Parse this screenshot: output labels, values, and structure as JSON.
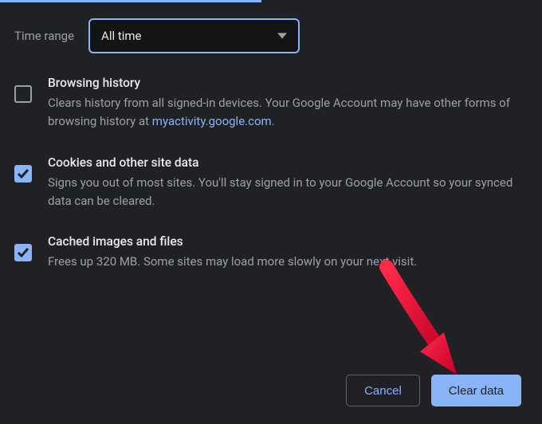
{
  "time_range": {
    "label": "Time range",
    "selected": "All time"
  },
  "options": [
    {
      "checked": false,
      "title": "Browsing history",
      "desc_before": "Clears history from all signed-in devices. Your Google Account may have other forms of browsing history at ",
      "link_text": "myactivity.google.com",
      "desc_after": "."
    },
    {
      "checked": true,
      "title": "Cookies and other site data",
      "desc_before": "Signs you out of most sites. You'll stay signed in to your Google Account so your synced data can be cleared.",
      "link_text": "",
      "desc_after": ""
    },
    {
      "checked": true,
      "title": "Cached images and files",
      "desc_before": "Frees up 320 MB. Some sites may load more slowly on your next visit.",
      "link_text": "",
      "desc_after": ""
    }
  ],
  "buttons": {
    "cancel": "Cancel",
    "clear": "Clear data"
  },
  "colors": {
    "accent": "#8ab4f8",
    "background": "#202124",
    "muted_text": "#9aa0a6"
  }
}
